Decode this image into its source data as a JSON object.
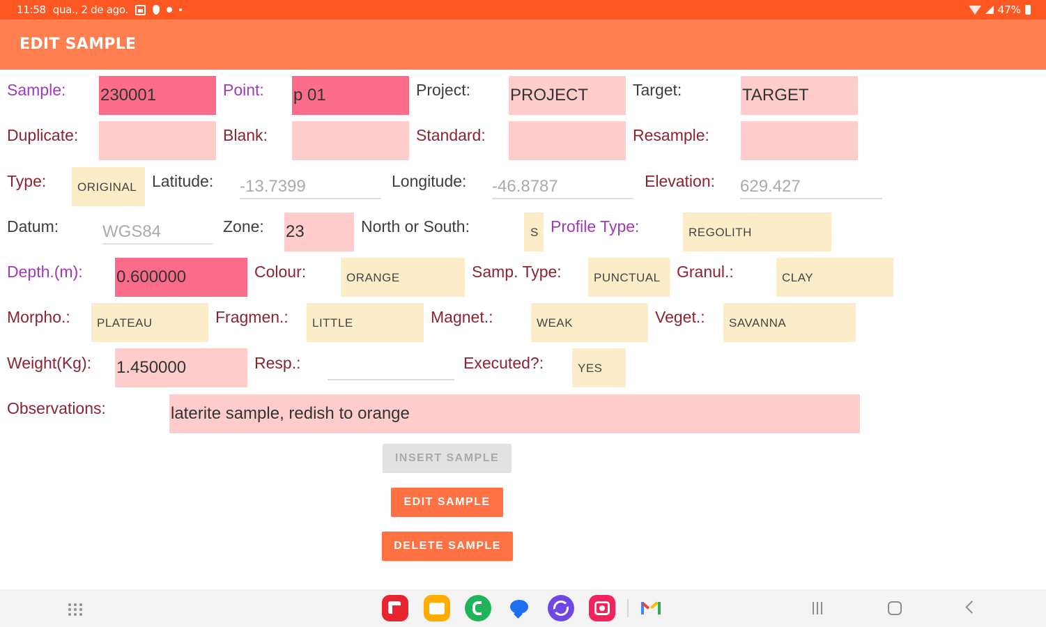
{
  "status_bar": {
    "time": "11:58",
    "date": "qua., 2 de ago.",
    "battery": "47%",
    "icons": [
      "calendar-icon",
      "location-pin-icon",
      "notification-dot-icon",
      "more-dot-icon",
      "wifi-icon",
      "signal-icon",
      "battery-icon"
    ]
  },
  "app_bar": {
    "title": "EDIT SAMPLE"
  },
  "form": {
    "sample": {
      "label": "Sample:",
      "value": "230001"
    },
    "point": {
      "label": "Point:",
      "value": "p 01"
    },
    "project": {
      "label": "Project:",
      "value": "PROJECT"
    },
    "target": {
      "label": "Target:",
      "value": "TARGET"
    },
    "duplicate": {
      "label": "Duplicate:",
      "value": ""
    },
    "blank": {
      "label": "Blank:",
      "value": ""
    },
    "standard": {
      "label": "Standard:",
      "value": ""
    },
    "resample": {
      "label": "Resample:",
      "value": ""
    },
    "type": {
      "label": "Type:",
      "value": "ORIGINAL"
    },
    "latitude": {
      "label": "Latitude:",
      "placeholder": "-13.7399"
    },
    "longitude": {
      "label": "Longitude:",
      "placeholder": "-46.8787"
    },
    "elevation": {
      "label": "Elevation:",
      "placeholder": "629.427"
    },
    "datum": {
      "label": "Datum:",
      "placeholder": "WGS84"
    },
    "zone": {
      "label": "Zone:",
      "value": "23"
    },
    "north_south": {
      "label": "North or South:",
      "value": "S"
    },
    "profile_type": {
      "label": "Profile Type:",
      "value": "REGOLITH"
    },
    "depth": {
      "label": "Depth.(m):",
      "value": "0.600000"
    },
    "colour": {
      "label": "Colour:",
      "value": "ORANGE"
    },
    "samp_type": {
      "label": "Samp. Type:",
      "value": "PUNCTUAL"
    },
    "granul": {
      "label": "Granul.:",
      "value": "CLAY"
    },
    "morpho": {
      "label": "Morpho.:",
      "value": "PLATEAU"
    },
    "fragmen": {
      "label": "Fragmen.:",
      "value": "LITTLE"
    },
    "magnet": {
      "label": "Magnet.:",
      "value": "WEAK"
    },
    "veget": {
      "label": "Veget.:",
      "value": "SAVANNA"
    },
    "weight": {
      "label": "Weight(Kg):",
      "value": "1.450000"
    },
    "resp": {
      "label": "Resp.:",
      "value": ""
    },
    "executed": {
      "label": "Executed?:",
      "value": "YES"
    },
    "observations": {
      "label": "Observations:",
      "value": "laterite sample, redish to orange"
    }
  },
  "buttons": {
    "insert": "INSERT SAMPLE",
    "edit": "EDIT SAMPLE",
    "delete": "DELETE SAMPLE"
  },
  "colors": {
    "status_bar": "#ff5722",
    "app_bar": "#ff7f50",
    "field_fill": "#ffcccc",
    "field_highlight": "#fb6b8a",
    "spinner_fill": "#fdecc8",
    "label_text": "#8b2332",
    "label_required": "#a03ab8",
    "button_primary": "#ff7043"
  },
  "nav_bar": {
    "apps": [
      "app-drawer-icon",
      "flipboard-icon",
      "my-files-icon",
      "phone-icon",
      "messages-icon",
      "internet-icon",
      "screen-recorder-icon",
      "gmail-icon"
    ],
    "keys": [
      "recents-icon",
      "home-icon",
      "back-icon"
    ]
  }
}
